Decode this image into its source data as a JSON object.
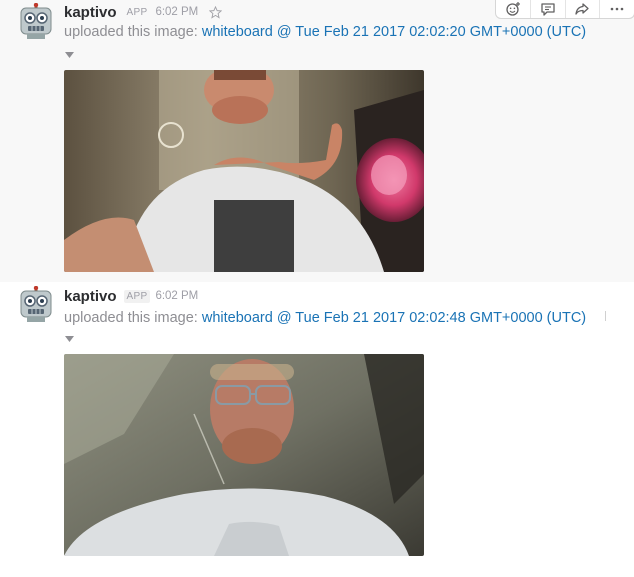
{
  "messages": [
    {
      "sender": "kaptivo",
      "badge": "APP",
      "time": "6:02 PM",
      "text_prefix": "uploaded this image:",
      "link_text": "whiteboard @ Tue Feb 21 2017 02:02:20 GMT+0000 (UTC)"
    },
    {
      "sender": "kaptivo",
      "badge": "APP",
      "time": "6:02 PM",
      "text_prefix": "uploaded this image:",
      "link_text": "whiteboard @ Tue Feb 21 2017 02:02:48 GMT+0000 (UTC)"
    }
  ],
  "toolbar": {
    "icons": [
      "add-reaction-icon",
      "start-thread-icon",
      "share-message-icon",
      "more-actions-icon"
    ]
  }
}
